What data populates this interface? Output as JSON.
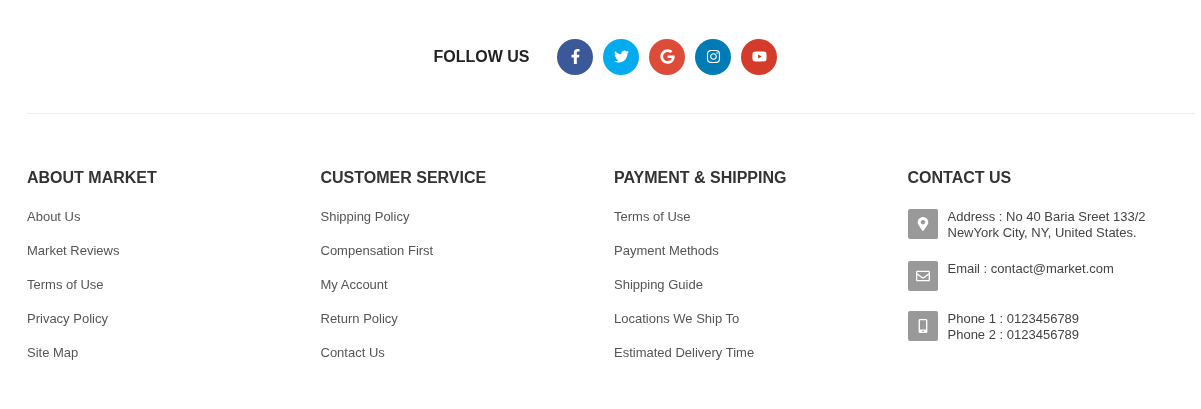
{
  "follow": {
    "title": "FOLLOW US",
    "socials": [
      {
        "kind": "facebook",
        "color": "#3b5998"
      },
      {
        "kind": "twitter",
        "color": "#00aced"
      },
      {
        "kind": "google",
        "color": "#dd4b39"
      },
      {
        "kind": "instagram",
        "color": "#007bb6"
      },
      {
        "kind": "youtube",
        "color": "#d43b2a"
      }
    ]
  },
  "columns": [
    {
      "title": "ABOUT MARKET",
      "links": [
        "About Us",
        "Market Reviews",
        "Terms of Use",
        "Privacy Policy",
        "Site Map"
      ]
    },
    {
      "title": "CUSTOMER SERVICE",
      "links": [
        "Shipping Policy",
        "Compensation First",
        "My Account",
        "Return Policy",
        "Contact Us"
      ]
    },
    {
      "title": "PAYMENT & SHIPPING",
      "links": [
        "Terms of Use",
        "Payment Methods",
        "Shipping Guide",
        "Locations We Ship To",
        "Estimated Delivery Time"
      ]
    }
  ],
  "contact": {
    "title": "CONTACT US",
    "items": [
      {
        "kind": "address",
        "lines": [
          "Address : No 40 Baria Sreet 133/2",
          "NewYork City, NY, United States."
        ]
      },
      {
        "kind": "email",
        "lines": [
          "Email : contact@market.com"
        ]
      },
      {
        "kind": "phone",
        "lines": [
          "Phone 1 : 0123456789",
          "Phone 2 : 0123456789"
        ]
      }
    ]
  }
}
